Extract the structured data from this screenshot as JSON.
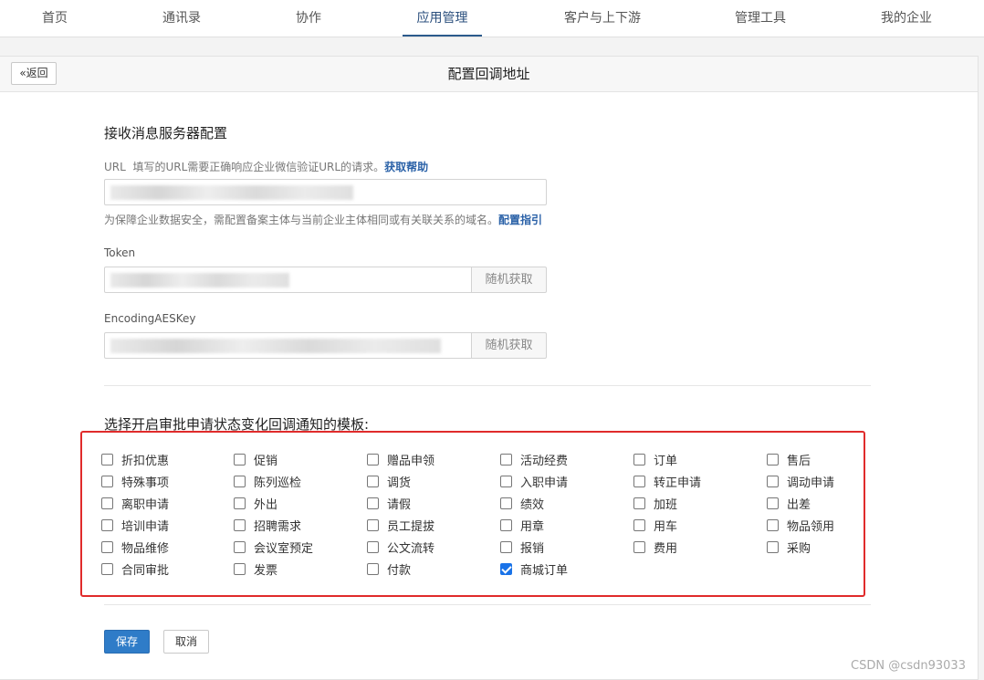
{
  "nav": {
    "items": [
      "首页",
      "通讯录",
      "协作",
      "应用管理",
      "客户与上下游",
      "管理工具",
      "我的企业"
    ],
    "active": "应用管理"
  },
  "header": {
    "back_label": "返回",
    "back_icon": "double-chevron-left-icon",
    "title": "配置回调地址"
  },
  "form": {
    "section_title": "接收消息服务器配置",
    "url": {
      "label": "URL",
      "hint": "填写的URL需要正确响应企业微信验证URL的请求。",
      "help_link": "获取帮助",
      "value_blurred": true
    },
    "security_note": "为保障企业数据安全，需配置备案主体与当前企业主体相同或有关联关系的域名。",
    "security_link": "配置指引",
    "token": {
      "label": "Token",
      "value_blurred": true,
      "random_button": "随机获取"
    },
    "aes_key": {
      "label": "EncodingAESKey",
      "value_blurred": true,
      "random_button": "随机获取"
    }
  },
  "templates": {
    "title": "选择开启审批申请状态变化回调通知的模板:",
    "highlight_color": "#e02b2b",
    "checkbox_color": "#1a73e8",
    "items": [
      {
        "label": "折扣优惠",
        "checked": false
      },
      {
        "label": "促销",
        "checked": false
      },
      {
        "label": "赠品申领",
        "checked": false
      },
      {
        "label": "活动经费",
        "checked": false
      },
      {
        "label": "订单",
        "checked": false
      },
      {
        "label": "售后",
        "checked": false
      },
      {
        "label": "特殊事项",
        "checked": false
      },
      {
        "label": "陈列巡检",
        "checked": false
      },
      {
        "label": "调货",
        "checked": false
      },
      {
        "label": "入职申请",
        "checked": false
      },
      {
        "label": "转正申请",
        "checked": false
      },
      {
        "label": "调动申请",
        "checked": false
      },
      {
        "label": "离职申请",
        "checked": false
      },
      {
        "label": "外出",
        "checked": false
      },
      {
        "label": "请假",
        "checked": false
      },
      {
        "label": "绩效",
        "checked": false
      },
      {
        "label": "加班",
        "checked": false
      },
      {
        "label": "出差",
        "checked": false
      },
      {
        "label": "培训申请",
        "checked": false
      },
      {
        "label": "招聘需求",
        "checked": false
      },
      {
        "label": "员工提拔",
        "checked": false
      },
      {
        "label": "用章",
        "checked": false
      },
      {
        "label": "用车",
        "checked": false
      },
      {
        "label": "物品领用",
        "checked": false
      },
      {
        "label": "物品维修",
        "checked": false
      },
      {
        "label": "会议室预定",
        "checked": false
      },
      {
        "label": "公文流转",
        "checked": false
      },
      {
        "label": "报销",
        "checked": false
      },
      {
        "label": "费用",
        "checked": false
      },
      {
        "label": "采购",
        "checked": false
      },
      {
        "label": "合同审批",
        "checked": false
      },
      {
        "label": "发票",
        "checked": false
      },
      {
        "label": "付款",
        "checked": false
      },
      {
        "label": "商城订单",
        "checked": true
      }
    ]
  },
  "actions": {
    "save": "保存",
    "cancel": "取消"
  },
  "watermark": "CSDN @csdn93033"
}
